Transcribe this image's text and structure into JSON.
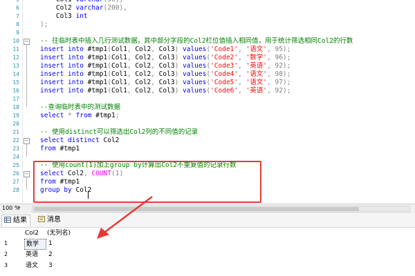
{
  "editor": {
    "lines": [
      {
        "n": "5",
        "top": 0,
        "tokens": [
          {
            "t": "tx",
            "v": "    Col1 "
          },
          {
            "t": "kw",
            "v": "varchar"
          },
          {
            "t": "gr",
            "v": "(50),"
          }
        ]
      },
      {
        "n": "6",
        "tokens": [
          {
            "t": "tx",
            "v": "    Col2 "
          },
          {
            "t": "kw",
            "v": "varchar"
          },
          {
            "t": "gr",
            "v": "(200),"
          }
        ]
      },
      {
        "n": "7",
        "tokens": [
          {
            "t": "tx",
            "v": "    Col3 "
          },
          {
            "t": "kw",
            "v": "int"
          }
        ]
      },
      {
        "n": "8",
        "tokens": [
          {
            "t": "gr",
            "v": ");"
          }
        ]
      },
      {
        "n": "9",
        "tokens": []
      },
      {
        "n": "10",
        "tokens": [
          {
            "t": "cm",
            "v": "-- 往临时表中插入几行测试数据，其中部分字段的Col2栏位值插入相同值，用于统计筛选相同Col2的行数"
          }
        ]
      },
      {
        "n": "11",
        "tokens": [
          {
            "t": "kw",
            "v": "insert into "
          },
          {
            "t": "tx",
            "v": "#tmp1"
          },
          {
            "t": "gr",
            "v": "("
          },
          {
            "t": "tx",
            "v": "Col1"
          },
          {
            "t": "gr",
            "v": ", "
          },
          {
            "t": "tx",
            "v": "Col2"
          },
          {
            "t": "gr",
            "v": ", "
          },
          {
            "t": "tx",
            "v": "Col3"
          },
          {
            "t": "gr",
            "v": ") "
          },
          {
            "t": "kw",
            "v": "values"
          },
          {
            "t": "gr",
            "v": "("
          },
          {
            "t": "str",
            "v": "'Code1'"
          },
          {
            "t": "gr",
            "v": ", "
          },
          {
            "t": "str",
            "v": "'语文'"
          },
          {
            "t": "gr",
            "v": ", 95);"
          }
        ]
      },
      {
        "n": "12",
        "tokens": [
          {
            "t": "kw",
            "v": "insert into "
          },
          {
            "t": "tx",
            "v": "#tmp1"
          },
          {
            "t": "gr",
            "v": "("
          },
          {
            "t": "tx",
            "v": "Col1"
          },
          {
            "t": "gr",
            "v": ", "
          },
          {
            "t": "tx",
            "v": "Col2"
          },
          {
            "t": "gr",
            "v": ", "
          },
          {
            "t": "tx",
            "v": "Col3"
          },
          {
            "t": "gr",
            "v": ") "
          },
          {
            "t": "kw",
            "v": "values"
          },
          {
            "t": "gr",
            "v": "("
          },
          {
            "t": "str",
            "v": "'Code2'"
          },
          {
            "t": "gr",
            "v": ", "
          },
          {
            "t": "str",
            "v": "'数学'"
          },
          {
            "t": "gr",
            "v": ", 96);"
          }
        ]
      },
      {
        "n": "13",
        "tokens": [
          {
            "t": "kw",
            "v": "insert into "
          },
          {
            "t": "tx",
            "v": "#tmp1"
          },
          {
            "t": "gr",
            "v": "("
          },
          {
            "t": "tx",
            "v": "Col1"
          },
          {
            "t": "gr",
            "v": ", "
          },
          {
            "t": "tx",
            "v": "Col2"
          },
          {
            "t": "gr",
            "v": ", "
          },
          {
            "t": "tx",
            "v": "Col3"
          },
          {
            "t": "gr",
            "v": ") "
          },
          {
            "t": "kw",
            "v": "values"
          },
          {
            "t": "gr",
            "v": "("
          },
          {
            "t": "str",
            "v": "'Code3'"
          },
          {
            "t": "gr",
            "v": ", "
          },
          {
            "t": "str",
            "v": "'英语'"
          },
          {
            "t": "gr",
            "v": ", 92);"
          }
        ]
      },
      {
        "n": "14",
        "tokens": [
          {
            "t": "kw",
            "v": "insert into "
          },
          {
            "t": "tx",
            "v": "#tmp1"
          },
          {
            "t": "gr",
            "v": "("
          },
          {
            "t": "tx",
            "v": "Col1"
          },
          {
            "t": "gr",
            "v": ", "
          },
          {
            "t": "tx",
            "v": "Col2"
          },
          {
            "t": "gr",
            "v": ", "
          },
          {
            "t": "tx",
            "v": "Col3"
          },
          {
            "t": "gr",
            "v": ") "
          },
          {
            "t": "kw",
            "v": "values"
          },
          {
            "t": "gr",
            "v": "("
          },
          {
            "t": "str",
            "v": "'Code4'"
          },
          {
            "t": "gr",
            "v": ", "
          },
          {
            "t": "str",
            "v": "'语文'"
          },
          {
            "t": "gr",
            "v": ", 98);"
          }
        ]
      },
      {
        "n": "15",
        "tokens": [
          {
            "t": "kw",
            "v": "insert into "
          },
          {
            "t": "tx",
            "v": "#tmp1"
          },
          {
            "t": "gr",
            "v": "("
          },
          {
            "t": "tx",
            "v": "Col1"
          },
          {
            "t": "gr",
            "v": ", "
          },
          {
            "t": "tx",
            "v": "Col2"
          },
          {
            "t": "gr",
            "v": ", "
          },
          {
            "t": "tx",
            "v": "Col3"
          },
          {
            "t": "gr",
            "v": ") "
          },
          {
            "t": "kw",
            "v": "values"
          },
          {
            "t": "gr",
            "v": "("
          },
          {
            "t": "str",
            "v": "'Code5'"
          },
          {
            "t": "gr",
            "v": ", "
          },
          {
            "t": "str",
            "v": "'语文'"
          },
          {
            "t": "gr",
            "v": ", 97);"
          }
        ]
      },
      {
        "n": "16",
        "tokens": [
          {
            "t": "kw",
            "v": "insert into "
          },
          {
            "t": "tx",
            "v": "#tmp1"
          },
          {
            "t": "gr",
            "v": "("
          },
          {
            "t": "tx",
            "v": "Col1"
          },
          {
            "t": "gr",
            "v": ", "
          },
          {
            "t": "tx",
            "v": "Col2"
          },
          {
            "t": "gr",
            "v": ", "
          },
          {
            "t": "tx",
            "v": "Col3"
          },
          {
            "t": "gr",
            "v": ") "
          },
          {
            "t": "kw",
            "v": "values"
          },
          {
            "t": "gr",
            "v": "("
          },
          {
            "t": "str",
            "v": "'Code6'"
          },
          {
            "t": "gr",
            "v": ", "
          },
          {
            "t": "str",
            "v": "'英语'"
          },
          {
            "t": "gr",
            "v": ", 92);"
          }
        ]
      },
      {
        "n": "17",
        "tokens": []
      },
      {
        "n": "18",
        "tokens": [
          {
            "t": "cm",
            "v": "--查询临时表中的测试数据"
          }
        ]
      },
      {
        "n": "19",
        "tokens": [
          {
            "t": "kw",
            "v": "select "
          },
          {
            "t": "gr",
            "v": "* "
          },
          {
            "t": "kw",
            "v": "from "
          },
          {
            "t": "tx",
            "v": "#tmp1"
          },
          {
            "t": "gr",
            "v": ";"
          }
        ]
      },
      {
        "n": "20",
        "tokens": []
      },
      {
        "n": "21",
        "tokens": [
          {
            "t": "cm",
            "v": "-- 使用distinct可以筛选出Col2列的不同值的记录"
          }
        ]
      },
      {
        "n": "22",
        "tokens": [
          {
            "t": "kw",
            "v": "select distinct "
          },
          {
            "t": "tx",
            "v": "Col2"
          }
        ]
      },
      {
        "n": "23",
        "tokens": [
          {
            "t": "kw",
            "v": "from "
          },
          {
            "t": "tx",
            "v": "#tmp1"
          }
        ]
      },
      {
        "n": "24",
        "tokens": []
      },
      {
        "n": "25",
        "tokens": [
          {
            "t": "cm",
            "v": "-- 使用count(1)加上group by计算出Col2不重复值的记录行数"
          }
        ]
      },
      {
        "n": "26",
        "tokens": [
          {
            "t": "kw",
            "v": "select "
          },
          {
            "t": "tx",
            "v": "Col2"
          },
          {
            "t": "gr",
            "v": ", "
          },
          {
            "t": "fn",
            "v": "COUNT"
          },
          {
            "t": "gr",
            "v": "(1)"
          }
        ]
      },
      {
        "n": "27",
        "tokens": [
          {
            "t": "kw",
            "v": "from "
          },
          {
            "t": "tx",
            "v": "#tmp1"
          }
        ]
      },
      {
        "n": "28",
        "tokens": [
          {
            "t": "kw",
            "v": "group by "
          },
          {
            "t": "tx",
            "v": "Col2"
          }
        ]
      }
    ]
  },
  "zoom": {
    "label": "100 %",
    "arrow": "▾"
  },
  "tabs": {
    "results_label": "结果",
    "messages_label": "消息"
  },
  "results": {
    "columns": [
      "Col2",
      "(无列名)"
    ],
    "rows": [
      {
        "num": "1",
        "col2": "数学",
        "count": "1"
      },
      {
        "num": "2",
        "col2": "英语",
        "count": "2"
      },
      {
        "num": "3",
        "col2": "语文",
        "count": "3"
      }
    ]
  },
  "icons": {
    "results": "grid-icon",
    "messages": "message-icon"
  },
  "colors": {
    "keyword": "#0000ff",
    "function": "#ff00ff",
    "string": "#ff0000",
    "comment": "#008000",
    "annotation": "#e53935"
  }
}
